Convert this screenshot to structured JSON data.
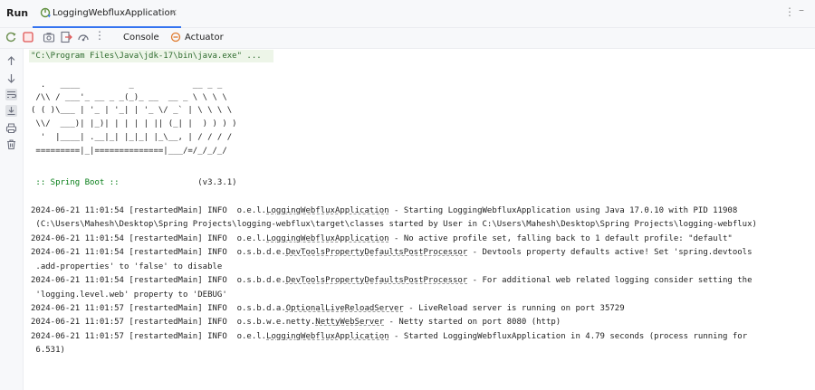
{
  "window": {
    "panel_title": "Run",
    "tab_label": "LoggingWebfluxApplication"
  },
  "toolbar": {
    "tabs": [
      {
        "label": "Console"
      },
      {
        "label": "Actuator"
      }
    ]
  },
  "console": {
    "command": "\"C:\\Program Files\\Java\\jdk-17\\bin\\java.exe\" ...",
    "banner": [
      "  .   ____          _            __ _ _",
      " /\\\\ / ___'_ __ _ _(_)_ __  __ _ \\ \\ \\ \\",
      "( ( )\\___ | '_ | '_| | '_ \\/ _` | \\ \\ \\ \\",
      " \\\\/  ___)| |_)| | | | | || (_| |  ) ) ) )",
      "  '  |____| .__|_| |_|_| |_\\__, | / / / /",
      " =========|_|==============|___/=/_/_/_/"
    ],
    "spring_boot_label": " :: Spring Boot :: ",
    "spring_boot_version": "               (v3.3.1)",
    "logs": [
      {
        "prefix": "2024-06-21 11:01:54 [restartedMain] INFO  o.e.l.",
        "cls": "LoggingWebfluxApplication",
        "msg": " - Starting LoggingWebfluxApplication using Java 17.0.10 with PID 11908"
      },
      {
        "prefix": " (C:\\Users\\Mahesh\\Desktop\\Spring Projects\\logging-webflux\\target\\classes started by User in C:\\Users\\Mahesh\\Desktop\\Spring Projects\\logging-webflux)",
        "cls": "",
        "msg": ""
      },
      {
        "prefix": "2024-06-21 11:01:54 [restartedMain] INFO  o.e.l.",
        "cls": "LoggingWebfluxApplication",
        "msg": " - No active profile set, falling back to 1 default profile: \"default\""
      },
      {
        "prefix": "2024-06-21 11:01:54 [restartedMain] INFO  o.s.b.d.e.",
        "cls": "DevToolsPropertyDefaultsPostProcessor",
        "msg": " - Devtools property defaults active! Set 'spring.devtools"
      },
      {
        "prefix": " .add-properties' to 'false' to disable",
        "cls": "",
        "msg": ""
      },
      {
        "prefix": "2024-06-21 11:01:54 [restartedMain] INFO  o.s.b.d.e.",
        "cls": "DevToolsPropertyDefaultsPostProcessor",
        "msg": " - For additional web related logging consider setting the"
      },
      {
        "prefix": " 'logging.level.web' property to 'DEBUG'",
        "cls": "",
        "msg": ""
      },
      {
        "prefix": "2024-06-21 11:01:57 [restartedMain] INFO  o.s.b.d.a.",
        "cls": "OptionalLiveReloadServer",
        "msg": " - LiveReload server is running on port 35729"
      },
      {
        "prefix": "2024-06-21 11:01:57 [restartedMain] INFO  o.s.b.w.e.netty.",
        "cls": "NettyWebServer",
        "msg": " - Netty started on port 8080 (http)"
      },
      {
        "prefix": "2024-06-21 11:01:57 [restartedMain] INFO  o.e.l.",
        "cls": "LoggingWebfluxApplication",
        "msg": " - Started LoggingWebfluxApplication in 4.79 seconds (process running for"
      },
      {
        "prefix": " 6.531)",
        "cls": "",
        "msg": ""
      }
    ]
  }
}
